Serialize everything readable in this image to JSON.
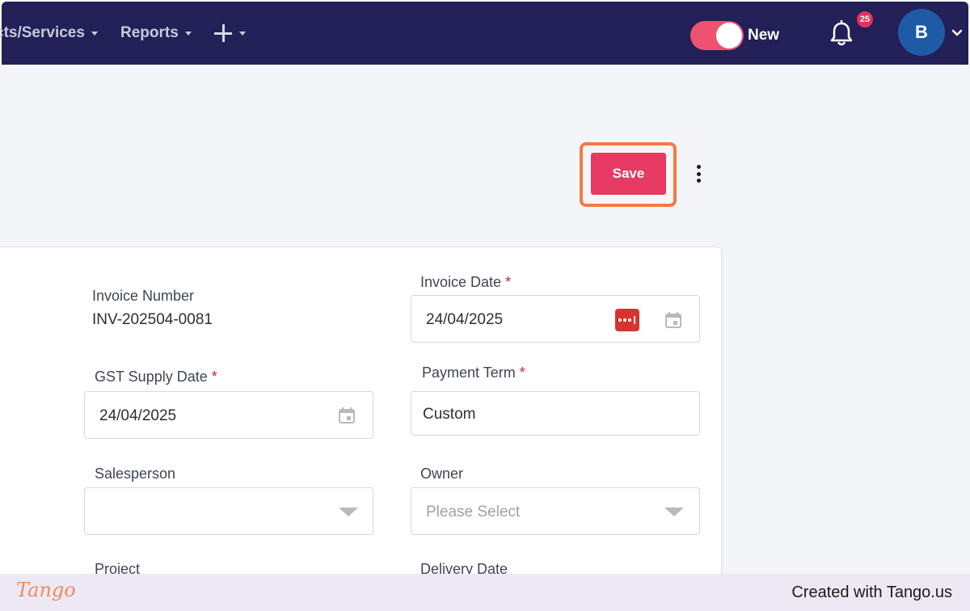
{
  "nav": {
    "items": [
      {
        "label": "cts/Services"
      },
      {
        "label": "Reports"
      }
    ],
    "add_menu_icon": "plus-icon",
    "toggle": {
      "label": "New",
      "on": true,
      "color": "#ee5270"
    },
    "notifications": {
      "count": "25"
    },
    "avatar": {
      "initial": "B"
    }
  },
  "toolbar": {
    "save_label": "Save",
    "more_icon": "more-vertical-icon"
  },
  "form": {
    "invoice_number": {
      "label": "Invoice Number",
      "value": "INV-202504-0081"
    },
    "invoice_date": {
      "label": "Invoice Date",
      "required": "*",
      "value": "24/04/2025"
    },
    "gst_supply_date": {
      "label": "GST Supply Date",
      "required": "*",
      "value": "24/04/2025"
    },
    "payment_term": {
      "label": "Payment Term",
      "required": "*",
      "value": "Custom"
    },
    "salesperson": {
      "label": "Salesperson",
      "value": ""
    },
    "owner": {
      "label": "Owner",
      "placeholder": "Please Select"
    },
    "project": {
      "label": "Project"
    },
    "delivery_date": {
      "label": "Delivery Date"
    }
  },
  "footer": {
    "logo": "Tango",
    "credit": "Created with Tango.us"
  },
  "colors": {
    "navbar": "#222057",
    "accent": "#e63a63",
    "highlight": "#f47a44"
  }
}
